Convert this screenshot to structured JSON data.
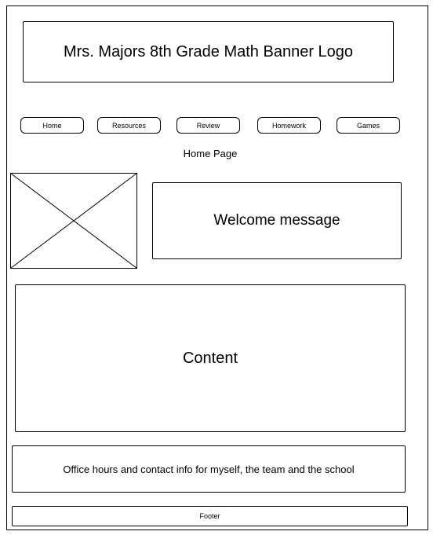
{
  "banner": {
    "title": "Mrs. Majors 8th Grade Math Banner Logo"
  },
  "nav": {
    "items": [
      {
        "label": "Home"
      },
      {
        "label": "Resources"
      },
      {
        "label": "Review"
      },
      {
        "label": "Homework"
      },
      {
        "label": "Games"
      }
    ]
  },
  "page": {
    "title": "Home Page"
  },
  "welcome": {
    "text": "Welcome message"
  },
  "content": {
    "text": "Content"
  },
  "office": {
    "text": "Office hours and contact info for myself, the team and the school"
  },
  "footer": {
    "text": "Footer"
  }
}
